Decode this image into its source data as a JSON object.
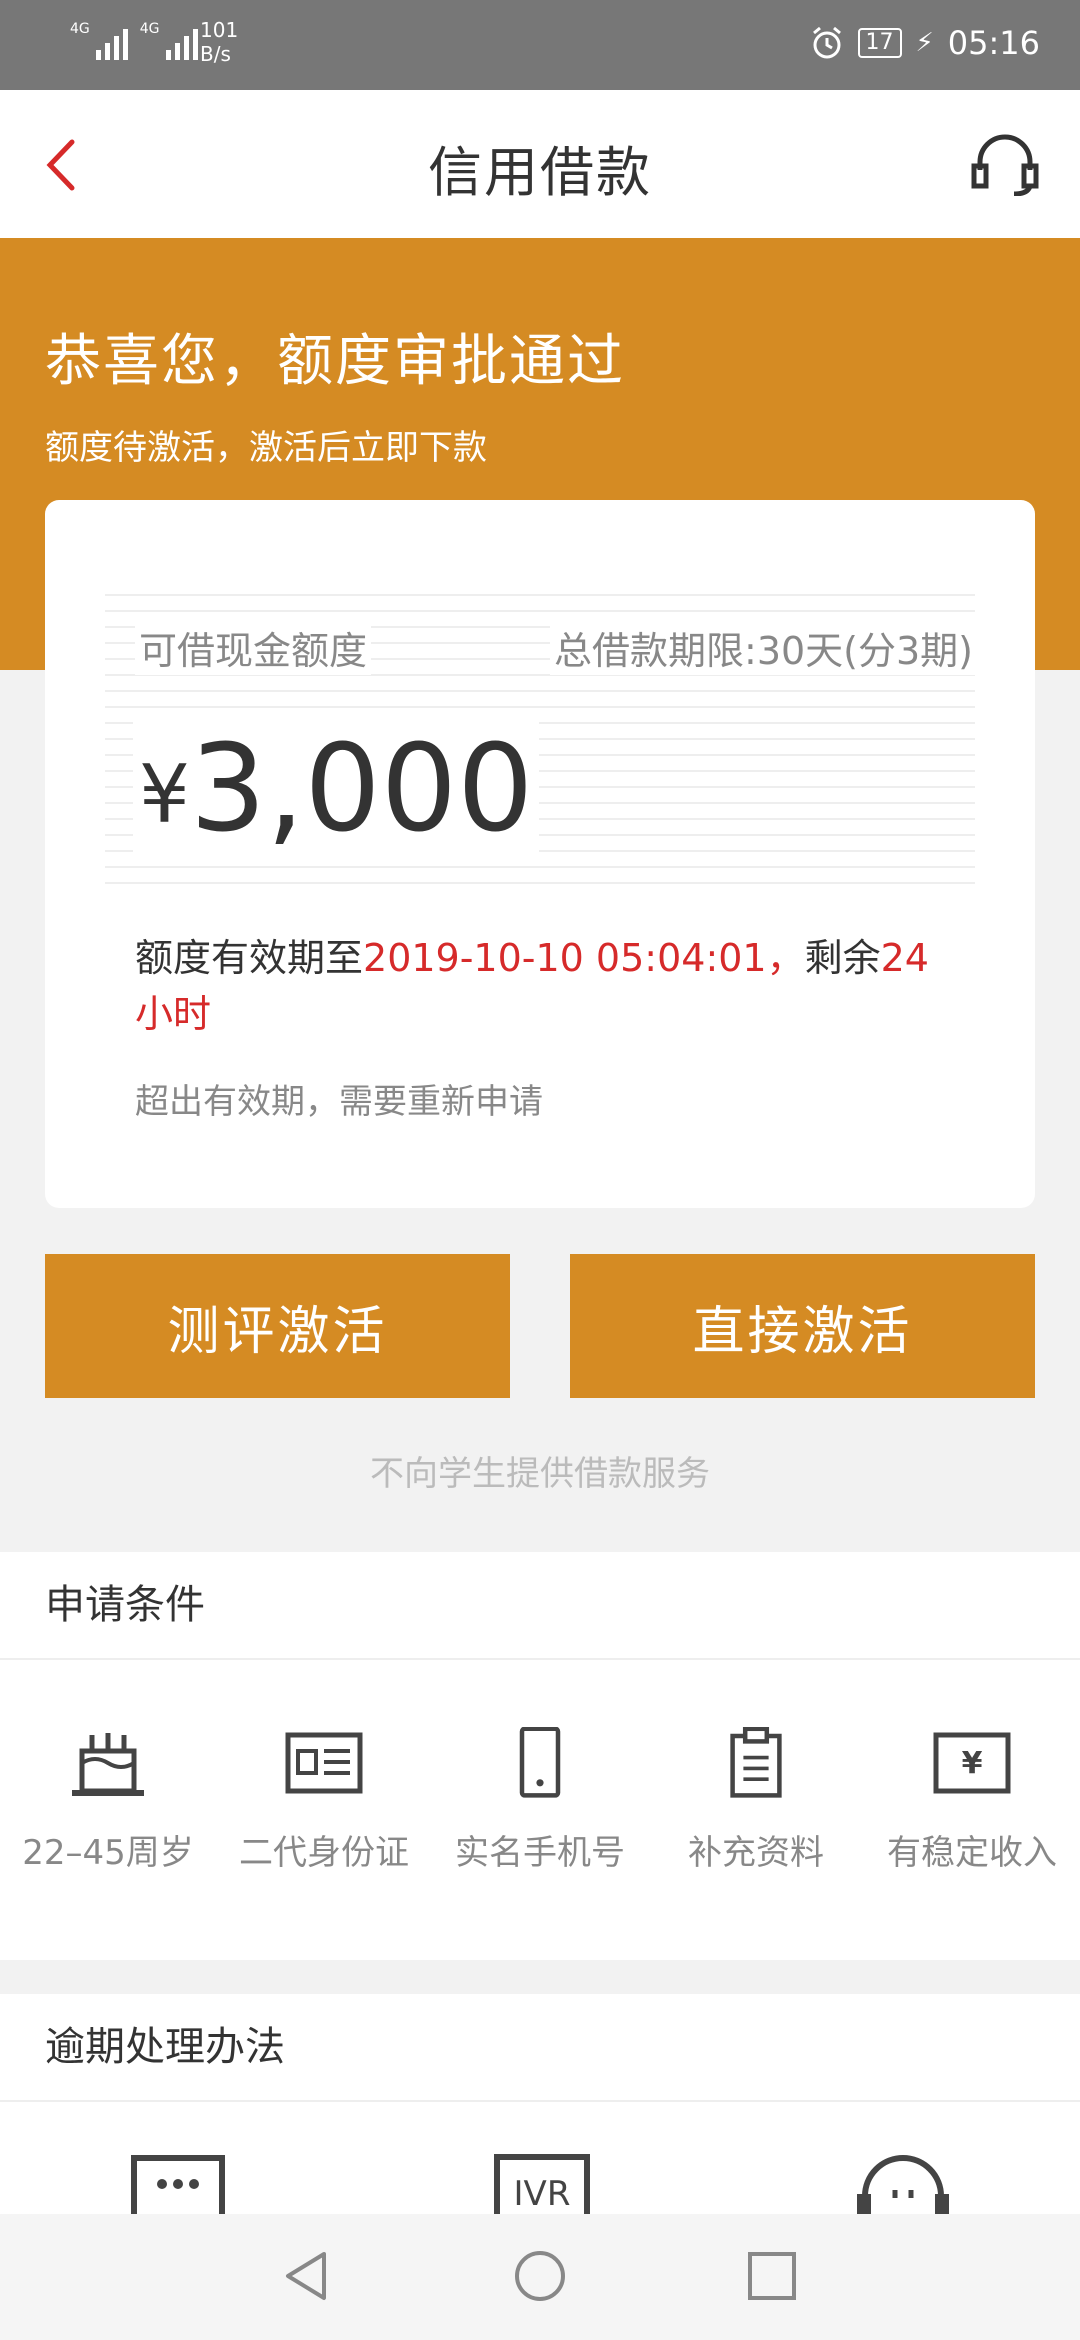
{
  "status_bar": {
    "signal_1": "4G",
    "signal_2": "4G",
    "net_speed_value": "101",
    "net_speed_unit": "B/s",
    "battery": "17",
    "time": "05:16"
  },
  "nav": {
    "title": "信用借款",
    "back_icon": "chevron-left-icon",
    "support_icon": "headset-icon"
  },
  "hero": {
    "headline": "恭喜您，额度审批通过",
    "subtitle": "额度待激活，激活后立即下款"
  },
  "card": {
    "label_left": "可借现金额度",
    "label_right": "总借款期限:30天(分3期)",
    "currency": "¥",
    "amount": "3,000",
    "validity_prefix": "额度有效期至",
    "validity_date": "2019-10-10 05:04:01，",
    "validity_remaining_label": "剩余",
    "validity_remaining_value": "24小时",
    "note": "超出有效期，需要重新申请"
  },
  "buttons": {
    "evaluate": "测评激活",
    "direct": "直接激活"
  },
  "notice": "不向学生提供借款服务",
  "requirements": {
    "title": "申请条件",
    "items": [
      {
        "label": "22–45周岁",
        "icon": "cake-icon"
      },
      {
        "label": "二代身份证",
        "icon": "id-card-icon"
      },
      {
        "label": "实名手机号",
        "icon": "phone-icon"
      },
      {
        "label": "补充资料",
        "icon": "clipboard-icon"
      },
      {
        "label": "有稳定收入",
        "icon": "income-icon"
      }
    ]
  },
  "overdue": {
    "title": "逾期处理办法",
    "items": [
      {
        "icon": "sms-icon"
      },
      {
        "label": "IVR",
        "icon": "ivr-icon"
      },
      {
        "icon": "headset-icon"
      }
    ]
  },
  "colors": {
    "accent": "#d58b23",
    "highlight": "#d62a2a",
    "status_bar": "#777777"
  }
}
